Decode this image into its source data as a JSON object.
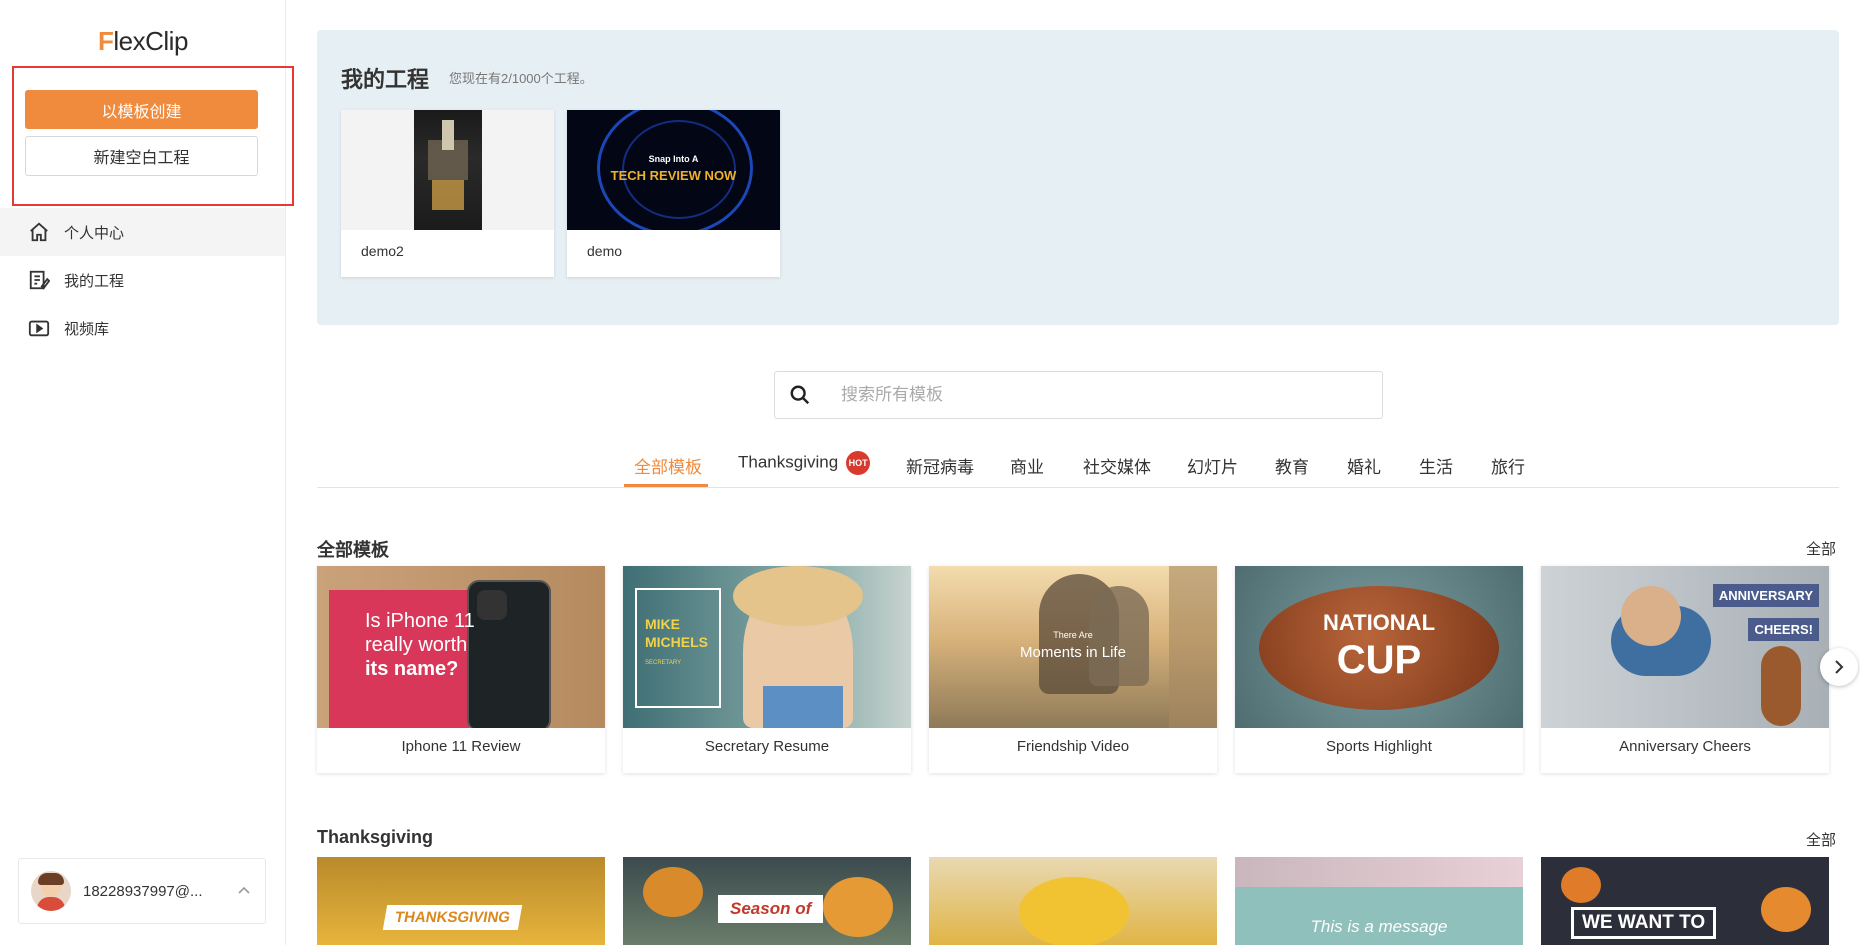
{
  "logo": {
    "prefix": "F",
    "text": "lexClip"
  },
  "sidebar": {
    "create_from_template": "以模板创建",
    "new_blank_project": "新建空白工程",
    "items": [
      {
        "label": "个人中心",
        "icon": "home-icon"
      },
      {
        "label": "我的工程",
        "icon": "edit-list-icon"
      },
      {
        "label": "视频库",
        "icon": "video-icon"
      }
    ],
    "user": {
      "name": "18228937997@..."
    }
  },
  "projects": {
    "title": "我的工程",
    "count_text": "您现在有2/1000个工程。",
    "items": [
      {
        "name": "demo2"
      },
      {
        "name": "demo",
        "thumb_line1": "Snap Into A",
        "thumb_line2": "TECH REVIEW NOW"
      }
    ]
  },
  "search": {
    "placeholder": "搜索所有模板"
  },
  "tabs": [
    {
      "label": "全部模板",
      "active": true
    },
    {
      "label": "Thanksgiving",
      "badge": "HOT"
    },
    {
      "label": "新冠病毒"
    },
    {
      "label": "商业"
    },
    {
      "label": "社交媒体"
    },
    {
      "label": "幻灯片"
    },
    {
      "label": "教育"
    },
    {
      "label": "婚礼"
    },
    {
      "label": "生活"
    },
    {
      "label": "旅行"
    }
  ],
  "sections": [
    {
      "title": "全部模板",
      "all_label": "全部",
      "templates": [
        {
          "name": "Iphone 11 Review",
          "thumb_text": [
            "Is iPhone 11",
            "really worth",
            "its name?"
          ]
        },
        {
          "name": "Secretary Resume",
          "thumb_text": [
            "MIKE",
            "MICHELS",
            "SECRETARY"
          ]
        },
        {
          "name": "Friendship Video",
          "thumb_text": [
            "There Are",
            "Moments in Life"
          ]
        },
        {
          "name": "Sports Highlight",
          "thumb_text": [
            "NATIONAL",
            "CUP"
          ]
        },
        {
          "name": "Anniversary Cheers",
          "thumb_text": [
            "ANNIVERSARY",
            "CHEERS!"
          ]
        }
      ]
    },
    {
      "title": "Thanksgiving",
      "all_label": "全部",
      "templates": [
        {
          "thumb_text": [
            "THANKSGIVING"
          ]
        },
        {
          "thumb_text": [
            "Season of"
          ]
        },
        {
          "thumb_text": []
        },
        {
          "thumb_text": [
            "This is a message"
          ]
        },
        {
          "thumb_text": [
            "WE WANT TO"
          ]
        }
      ]
    }
  ],
  "colors": {
    "accent": "#f08a3c",
    "panel": "#e6eff3",
    "hot": "#d83a2d",
    "highlight_border": "#e53935"
  }
}
